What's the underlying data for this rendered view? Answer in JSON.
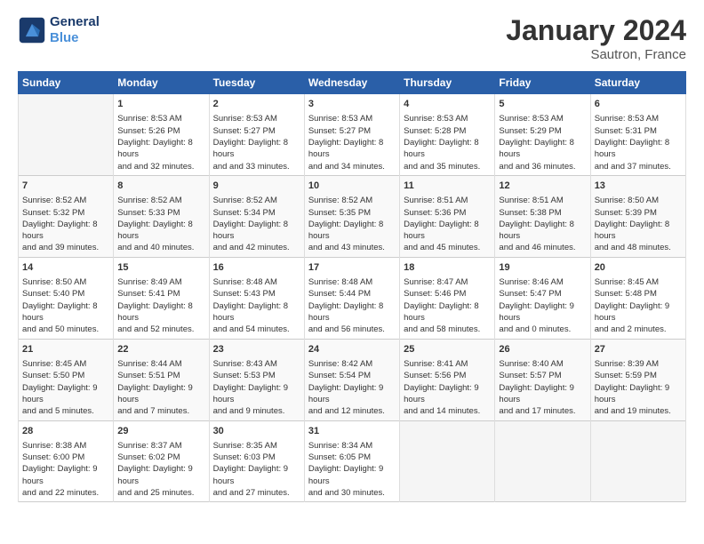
{
  "header": {
    "logo_line1": "General",
    "logo_line2": "Blue",
    "month_title": "January 2024",
    "subtitle": "Sautron, France"
  },
  "weekdays": [
    "Sunday",
    "Monday",
    "Tuesday",
    "Wednesday",
    "Thursday",
    "Friday",
    "Saturday"
  ],
  "weeks": [
    [
      {
        "day": "",
        "sunrise": "",
        "sunset": "",
        "daylight": ""
      },
      {
        "day": "1",
        "sunrise": "Sunrise: 8:53 AM",
        "sunset": "Sunset: 5:26 PM",
        "daylight": "Daylight: 8 hours and 32 minutes."
      },
      {
        "day": "2",
        "sunrise": "Sunrise: 8:53 AM",
        "sunset": "Sunset: 5:27 PM",
        "daylight": "Daylight: 8 hours and 33 minutes."
      },
      {
        "day": "3",
        "sunrise": "Sunrise: 8:53 AM",
        "sunset": "Sunset: 5:27 PM",
        "daylight": "Daylight: 8 hours and 34 minutes."
      },
      {
        "day": "4",
        "sunrise": "Sunrise: 8:53 AM",
        "sunset": "Sunset: 5:28 PM",
        "daylight": "Daylight: 8 hours and 35 minutes."
      },
      {
        "day": "5",
        "sunrise": "Sunrise: 8:53 AM",
        "sunset": "Sunset: 5:29 PM",
        "daylight": "Daylight: 8 hours and 36 minutes."
      },
      {
        "day": "6",
        "sunrise": "Sunrise: 8:53 AM",
        "sunset": "Sunset: 5:31 PM",
        "daylight": "Daylight: 8 hours and 37 minutes."
      }
    ],
    [
      {
        "day": "7",
        "sunrise": "Sunrise: 8:52 AM",
        "sunset": "Sunset: 5:32 PM",
        "daylight": "Daylight: 8 hours and 39 minutes."
      },
      {
        "day": "8",
        "sunrise": "Sunrise: 8:52 AM",
        "sunset": "Sunset: 5:33 PM",
        "daylight": "Daylight: 8 hours and 40 minutes."
      },
      {
        "day": "9",
        "sunrise": "Sunrise: 8:52 AM",
        "sunset": "Sunset: 5:34 PM",
        "daylight": "Daylight: 8 hours and 42 minutes."
      },
      {
        "day": "10",
        "sunrise": "Sunrise: 8:52 AM",
        "sunset": "Sunset: 5:35 PM",
        "daylight": "Daylight: 8 hours and 43 minutes."
      },
      {
        "day": "11",
        "sunrise": "Sunrise: 8:51 AM",
        "sunset": "Sunset: 5:36 PM",
        "daylight": "Daylight: 8 hours and 45 minutes."
      },
      {
        "day": "12",
        "sunrise": "Sunrise: 8:51 AM",
        "sunset": "Sunset: 5:38 PM",
        "daylight": "Daylight: 8 hours and 46 minutes."
      },
      {
        "day": "13",
        "sunrise": "Sunrise: 8:50 AM",
        "sunset": "Sunset: 5:39 PM",
        "daylight": "Daylight: 8 hours and 48 minutes."
      }
    ],
    [
      {
        "day": "14",
        "sunrise": "Sunrise: 8:50 AM",
        "sunset": "Sunset: 5:40 PM",
        "daylight": "Daylight: 8 hours and 50 minutes."
      },
      {
        "day": "15",
        "sunrise": "Sunrise: 8:49 AM",
        "sunset": "Sunset: 5:41 PM",
        "daylight": "Daylight: 8 hours and 52 minutes."
      },
      {
        "day": "16",
        "sunrise": "Sunrise: 8:48 AM",
        "sunset": "Sunset: 5:43 PM",
        "daylight": "Daylight: 8 hours and 54 minutes."
      },
      {
        "day": "17",
        "sunrise": "Sunrise: 8:48 AM",
        "sunset": "Sunset: 5:44 PM",
        "daylight": "Daylight: 8 hours and 56 minutes."
      },
      {
        "day": "18",
        "sunrise": "Sunrise: 8:47 AM",
        "sunset": "Sunset: 5:46 PM",
        "daylight": "Daylight: 8 hours and 58 minutes."
      },
      {
        "day": "19",
        "sunrise": "Sunrise: 8:46 AM",
        "sunset": "Sunset: 5:47 PM",
        "daylight": "Daylight: 9 hours and 0 minutes."
      },
      {
        "day": "20",
        "sunrise": "Sunrise: 8:45 AM",
        "sunset": "Sunset: 5:48 PM",
        "daylight": "Daylight: 9 hours and 2 minutes."
      }
    ],
    [
      {
        "day": "21",
        "sunrise": "Sunrise: 8:45 AM",
        "sunset": "Sunset: 5:50 PM",
        "daylight": "Daylight: 9 hours and 5 minutes."
      },
      {
        "day": "22",
        "sunrise": "Sunrise: 8:44 AM",
        "sunset": "Sunset: 5:51 PM",
        "daylight": "Daylight: 9 hours and 7 minutes."
      },
      {
        "day": "23",
        "sunrise": "Sunrise: 8:43 AM",
        "sunset": "Sunset: 5:53 PM",
        "daylight": "Daylight: 9 hours and 9 minutes."
      },
      {
        "day": "24",
        "sunrise": "Sunrise: 8:42 AM",
        "sunset": "Sunset: 5:54 PM",
        "daylight": "Daylight: 9 hours and 12 minutes."
      },
      {
        "day": "25",
        "sunrise": "Sunrise: 8:41 AM",
        "sunset": "Sunset: 5:56 PM",
        "daylight": "Daylight: 9 hours and 14 minutes."
      },
      {
        "day": "26",
        "sunrise": "Sunrise: 8:40 AM",
        "sunset": "Sunset: 5:57 PM",
        "daylight": "Daylight: 9 hours and 17 minutes."
      },
      {
        "day": "27",
        "sunrise": "Sunrise: 8:39 AM",
        "sunset": "Sunset: 5:59 PM",
        "daylight": "Daylight: 9 hours and 19 minutes."
      }
    ],
    [
      {
        "day": "28",
        "sunrise": "Sunrise: 8:38 AM",
        "sunset": "Sunset: 6:00 PM",
        "daylight": "Daylight: 9 hours and 22 minutes."
      },
      {
        "day": "29",
        "sunrise": "Sunrise: 8:37 AM",
        "sunset": "Sunset: 6:02 PM",
        "daylight": "Daylight: 9 hours and 25 minutes."
      },
      {
        "day": "30",
        "sunrise": "Sunrise: 8:35 AM",
        "sunset": "Sunset: 6:03 PM",
        "daylight": "Daylight: 9 hours and 27 minutes."
      },
      {
        "day": "31",
        "sunrise": "Sunrise: 8:34 AM",
        "sunset": "Sunset: 6:05 PM",
        "daylight": "Daylight: 9 hours and 30 minutes."
      },
      {
        "day": "",
        "sunrise": "",
        "sunset": "",
        "daylight": ""
      },
      {
        "day": "",
        "sunrise": "",
        "sunset": "",
        "daylight": ""
      },
      {
        "day": "",
        "sunrise": "",
        "sunset": "",
        "daylight": ""
      }
    ]
  ]
}
